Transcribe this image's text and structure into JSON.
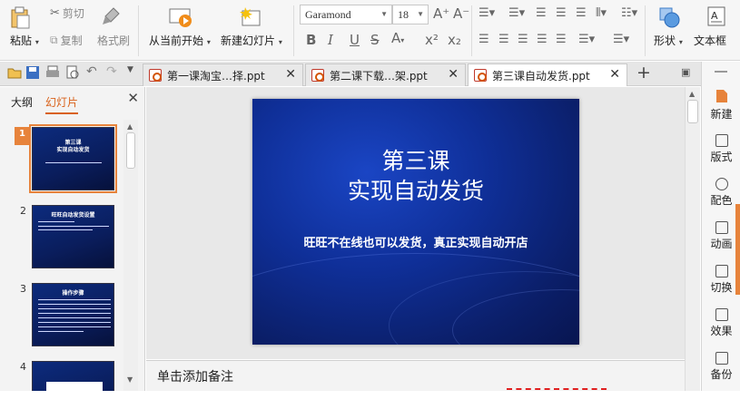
{
  "ribbon": {
    "paste": "粘贴",
    "cut": "剪切",
    "copy": "复制",
    "format_painter": "格式刷",
    "from_current": "从当前开始",
    "new_slide": "新建幻灯片",
    "font_name": "Garamond",
    "font_size": "18",
    "shape": "形状",
    "textbox": "文本框"
  },
  "tabs": [
    {
      "label": "第一课淘宝…择.ppt",
      "active": false
    },
    {
      "label": "第二课下载…架.ppt",
      "active": false
    },
    {
      "label": "第三课自动发货.ppt",
      "active": true
    }
  ],
  "panel": {
    "tab_outline": "大纲",
    "tab_slides": "幻灯片",
    "thumbs": [
      {
        "num": "1",
        "title": "第三课\n实现自动发货"
      },
      {
        "num": "2",
        "title": "旺旺自动发货设置"
      },
      {
        "num": "3",
        "title": "操作步骤"
      },
      {
        "num": "4",
        "title": ""
      }
    ]
  },
  "slide": {
    "title_line1": "第三课",
    "title_line2": "实现自动发货",
    "subtitle": "旺旺不在线也可以发货，真正实现自动开店"
  },
  "notes": {
    "placeholder": "单击添加备注"
  },
  "taskpane": [
    "新建",
    "版式",
    "配色",
    "动画",
    "切换",
    "效果",
    "备份"
  ],
  "colors": {
    "accent": "#e7833b",
    "slide_bg": "#0f2f98"
  }
}
